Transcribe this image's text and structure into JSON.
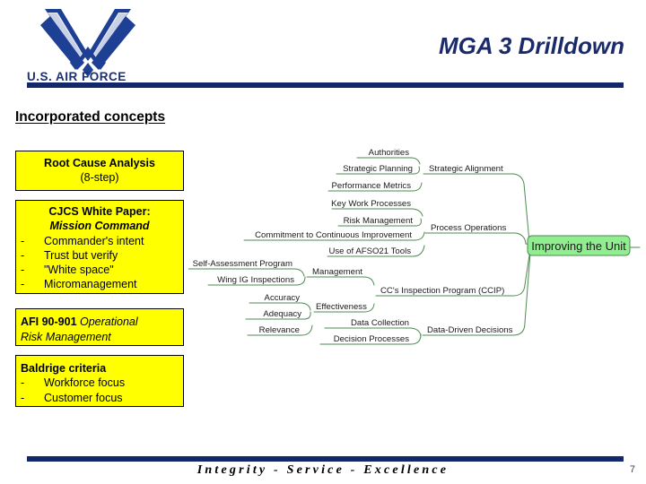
{
  "header": {
    "logo_icon": "us-air-force-wings-logo",
    "wordmark": "U.S. AIR FORCE",
    "title": "MGA 3 Drilldown",
    "rule_color": "#12286b"
  },
  "section": {
    "heading": "Incorporated concepts"
  },
  "concepts": {
    "root_cause": {
      "title": "Root Cause Analysis",
      "subtitle": "(8-step)"
    },
    "cjcs": {
      "title": "CJCS White Paper:",
      "subtitle": "Mission Command",
      "bullets": [
        "Commander's intent",
        "Trust but verify",
        "\"White space\"",
        "Micromanagement"
      ],
      "dash": "-"
    },
    "afi": {
      "title": "AFI 90-901",
      "title_italic": " Operational",
      "line2": "Risk Management"
    },
    "baldrige": {
      "title": "Baldrige criteria",
      "bullets": [
        "Workforce focus",
        "Customer focus"
      ],
      "dash": "-"
    },
    "box_fill": "#ffff00",
    "box_border": "#000000"
  },
  "mindmap": {
    "root": "Improving the Unit",
    "root_fill": "#90ee90",
    "branch_color": "#4e8b52",
    "branches": [
      {
        "mid": "Strategic Alignment",
        "leaves": [
          "Authorities",
          "Strategic Planning",
          "Performance Metrics"
        ]
      },
      {
        "mid": "Process Operations",
        "leaves": [
          "Key Work Processes",
          "Risk Management",
          "Commitment to Continuous Improvement",
          "Use of AFSO21 Tools"
        ]
      },
      {
        "mid": "CC's Inspection Program (CCIP)",
        "submids": [
          {
            "mid": "Management",
            "leaves": [
              "Self-Assessment Program",
              "Wing IG Inspections"
            ]
          },
          {
            "mid": "Effectiveness",
            "leaves": [
              "Accuracy",
              "Adequacy",
              "Relevance"
            ]
          }
        ]
      },
      {
        "mid": "Data-Driven Decisions",
        "leaves": [
          "Data Collection",
          "Decision Processes"
        ]
      }
    ]
  },
  "footer": {
    "motto": "Integrity - Service - Excellence",
    "page_number": "7"
  }
}
